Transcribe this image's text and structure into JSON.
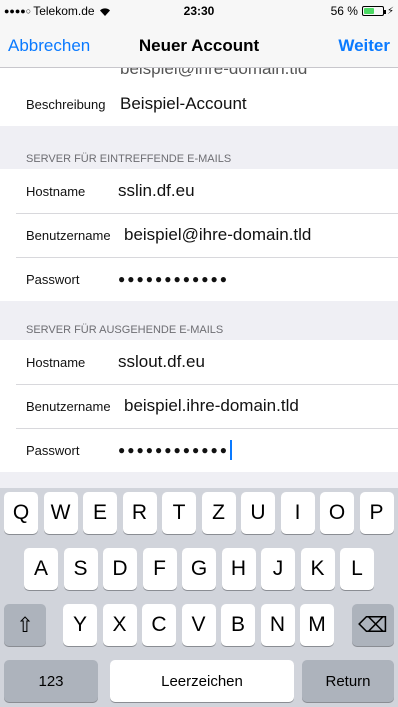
{
  "status_bar": {
    "signal": "●●●●○",
    "carrier": "Telekom.de",
    "time": "23:30",
    "battery_text": "56 %",
    "battery_level": 0.56
  },
  "nav": {
    "cancel_label": "Abbrechen",
    "title": "Neuer Account",
    "next_label": "Weiter"
  },
  "form": {
    "cut_off_value": "beispiel@ihre-domain.tld",
    "description": {
      "label": "Beschreibung",
      "value": "Beispiel-Account"
    },
    "incoming": {
      "header": "SERVER FÜR EINTREFFENDE E-MAILS",
      "hostname": {
        "label": "Hostname",
        "value": "sslin.df.eu"
      },
      "username": {
        "label": "Benutzername",
        "value": "beispiel@ihre-domain.tld"
      },
      "password": {
        "label": "Passwort",
        "value": "●●●●●●●●●●●●"
      }
    },
    "outgoing": {
      "header": "SERVER FÜR AUSGEHENDE E-MAILS",
      "hostname": {
        "label": "Hostname",
        "value": "sslout.df.eu"
      },
      "username": {
        "label": "Benutzername",
        "value": "beispiel.ihre-domain.tld"
      },
      "password": {
        "label": "Passwort",
        "value": "●●●●●●●●●●●●"
      }
    }
  },
  "keyboard": {
    "row1": [
      "Q",
      "W",
      "E",
      "R",
      "T",
      "Z",
      "U",
      "I",
      "O",
      "P"
    ],
    "row2": [
      "A",
      "S",
      "D",
      "F",
      "G",
      "H",
      "J",
      "K",
      "L"
    ],
    "row3": [
      "Y",
      "X",
      "C",
      "V",
      "B",
      "N",
      "M"
    ],
    "shift_icon": "⇧",
    "delete_icon": "⌫",
    "numbers_label": "123",
    "space_label": "Leerzeichen",
    "return_label": "Return"
  },
  "colors": {
    "accent": "#0a7aff",
    "background": "#efeff4",
    "keyboard": "#d1d4db",
    "battery": "#4cd964"
  }
}
